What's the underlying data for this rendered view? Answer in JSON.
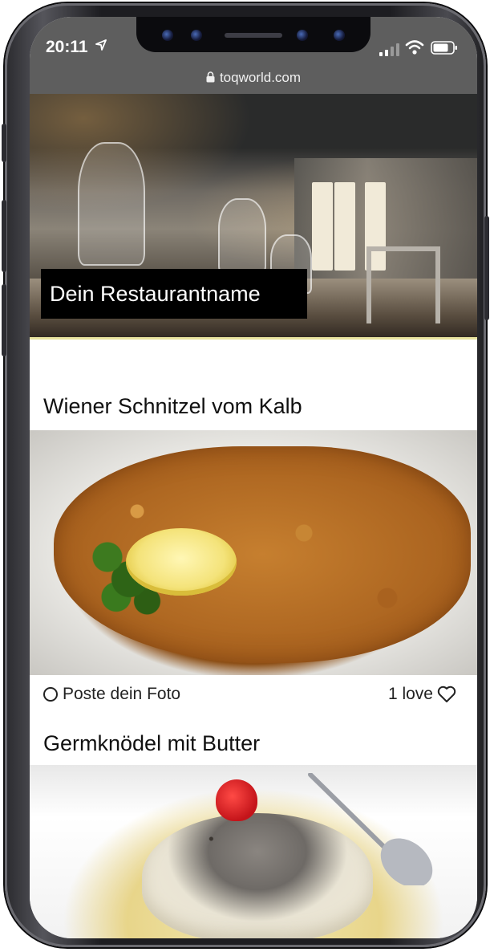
{
  "status_bar": {
    "time": "20:11",
    "url": "toqworld.com"
  },
  "hero": {
    "restaurant_name": "Dein Restaurantname"
  },
  "dishes": [
    {
      "title": "Wiener Schnitzel vom Kalb",
      "post_photo_label": "Poste dein Foto",
      "love_label": "1 love"
    },
    {
      "title": "Germknödel mit Butter"
    }
  ],
  "colors": {
    "status_bar_bg": "#5e5e5e",
    "name_badge_bg": "#000000",
    "text": "#111111"
  },
  "icons": [
    "location-arrow-icon",
    "signal-icon",
    "wifi-icon",
    "battery-icon",
    "lock-icon",
    "circle-icon",
    "heart-icon"
  ]
}
